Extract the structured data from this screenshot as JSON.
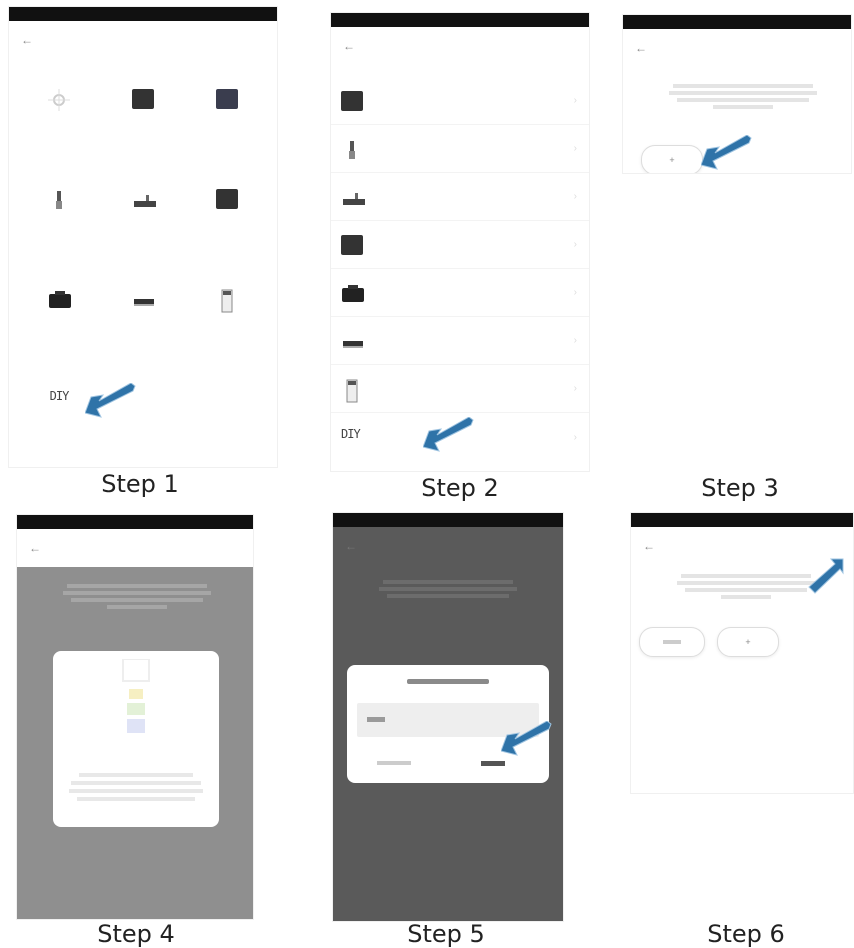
{
  "labels": {
    "step1": "Step 1",
    "step2": "Step 2",
    "step3": "Step 3",
    "step4": "Step 4",
    "step5": "Step 5",
    "step6": "Step 6"
  },
  "diy_text": "DIY",
  "colors": {
    "arrow": "#2f73a8",
    "status_bar": "#111111",
    "overlay_step4": "#8f8f8f",
    "overlay_step5": "#5a5a5a"
  },
  "icons": {
    "back": "back-arrow-icon",
    "pointer": "pointer-arrow-icon"
  }
}
